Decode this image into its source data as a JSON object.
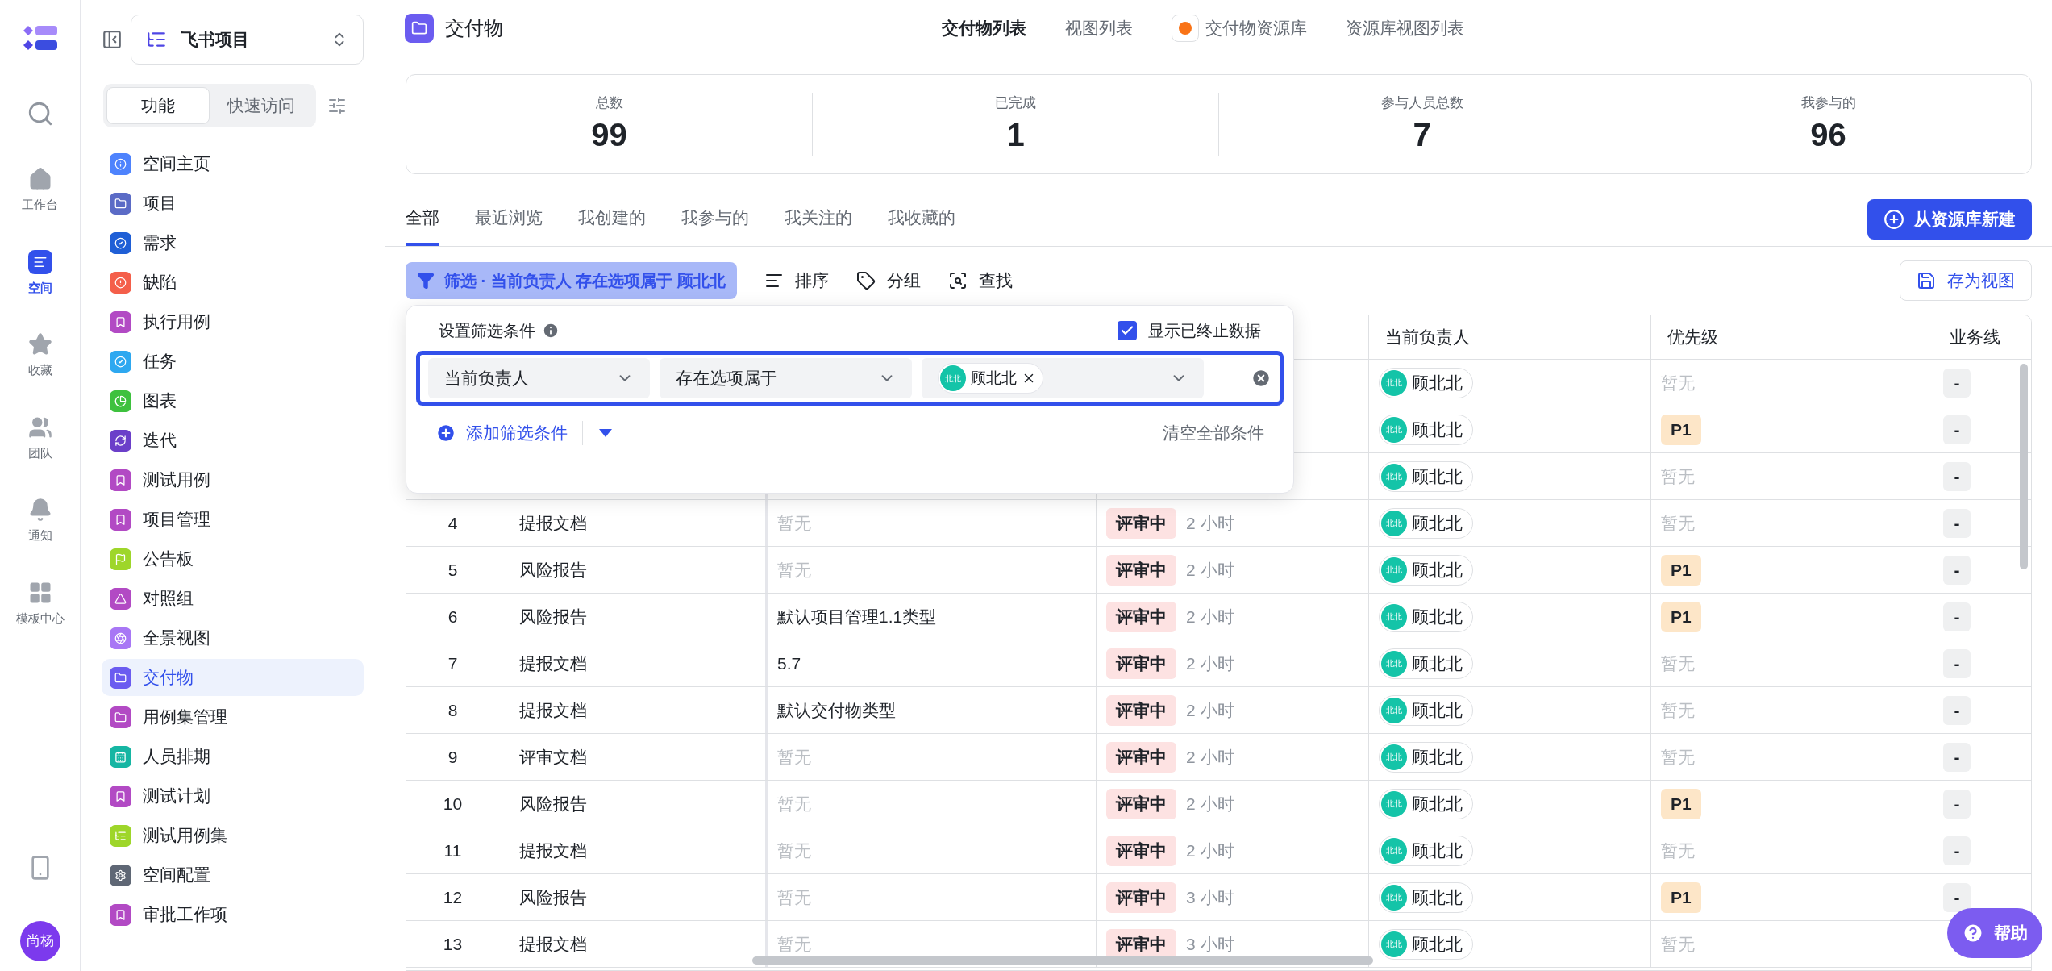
{
  "rail": {
    "items": [
      {
        "label": "工作台",
        "selected": false
      },
      {
        "label": "空间",
        "selected": true
      },
      {
        "label": "收藏",
        "selected": false
      },
      {
        "label": "团队",
        "selected": false
      },
      {
        "label": "通知",
        "selected": false
      },
      {
        "label": "模板中心",
        "selected": false
      }
    ],
    "avatar": "尚杨"
  },
  "sidebar": {
    "project": "飞书项目",
    "segments": [
      {
        "label": "功能",
        "selected": true
      },
      {
        "label": "快速访问",
        "selected": false
      }
    ],
    "items": [
      {
        "label": "空间主页",
        "color": "#4e83fd",
        "selected": false
      },
      {
        "label": "项目",
        "color": "#5b6bc6",
        "selected": false
      },
      {
        "label": "需求",
        "color": "#1f5fd6",
        "selected": false
      },
      {
        "label": "缺陷",
        "color": "#f45f4a",
        "selected": false
      },
      {
        "label": "执行用例",
        "color": "#b24ac4",
        "selected": false
      },
      {
        "label": "任务",
        "color": "#2ea8f0",
        "selected": false
      },
      {
        "label": "图表",
        "color": "#3ec13e",
        "selected": false
      },
      {
        "label": "迭代",
        "color": "#6b3fc9",
        "selected": false
      },
      {
        "label": "测试用例",
        "color": "#b24ac4",
        "selected": false
      },
      {
        "label": "项目管理",
        "color": "#b24ac4",
        "selected": false
      },
      {
        "label": "公告板",
        "color": "#9ed62a",
        "selected": false
      },
      {
        "label": "对照组",
        "color": "#b24ac4",
        "selected": false
      },
      {
        "label": "全景视图",
        "color": "#a877f5",
        "selected": false
      },
      {
        "label": "交付物",
        "color": "#6b5cf0",
        "selected": true
      },
      {
        "label": "用例集管理",
        "color": "#b24ac4",
        "selected": false
      },
      {
        "label": "人员排期",
        "color": "#16b6a3",
        "selected": false
      },
      {
        "label": "测试计划",
        "color": "#b24ac4",
        "selected": false
      },
      {
        "label": "测试用例集",
        "color": "#9ed62a",
        "selected": false
      },
      {
        "label": "空间配置",
        "color": "#5f6775",
        "selected": false
      },
      {
        "label": "审批工作项",
        "color": "#b24ac4",
        "selected": false
      }
    ]
  },
  "header": {
    "title": "交付物",
    "tabs": [
      {
        "label": "交付物列表",
        "selected": true
      },
      {
        "label": "视图列表",
        "selected": false
      },
      {
        "label": "交付物资源库",
        "selected": false
      },
      {
        "label": "资源库视图列表",
        "selected": false
      }
    ]
  },
  "stats": [
    {
      "label": "总数",
      "value": "99"
    },
    {
      "label": "已完成",
      "value": "1"
    },
    {
      "label": "参与人员总数",
      "value": "7"
    },
    {
      "label": "我参与的",
      "value": "96"
    }
  ],
  "view_tabs": [
    {
      "label": "全部",
      "selected": true
    },
    {
      "label": "最近浏览",
      "selected": false
    },
    {
      "label": "我创建的",
      "selected": false
    },
    {
      "label": "我参与的",
      "selected": false
    },
    {
      "label": "我关注的",
      "selected": false
    },
    {
      "label": "我收藏的",
      "selected": false
    }
  ],
  "new_button": "从资源库新建",
  "toolbar": {
    "filter": "筛选 · 当前负责人 存在选项属于 顾北北",
    "actions": [
      "排序",
      "分组",
      "查找"
    ],
    "save": "存为视图"
  },
  "filter_popup": {
    "title": "设置筛选条件",
    "show_terminated": {
      "label": "显示已终止数据",
      "checked": true
    },
    "field": "当前负责人",
    "operator": "存在选项属于",
    "value": {
      "avatar": "北北",
      "name": "顾北北"
    },
    "add": "添加筛选条件",
    "clear": "清空全部条件"
  },
  "table": {
    "columns": [
      "当前负责人",
      "优先级",
      "业务线"
    ],
    "rows": [
      {
        "owner": {
          "avatar": "北北",
          "name": "顾北北"
        },
        "priority": {
          "kind": "empty",
          "text": "暂无"
        },
        "business": "-"
      },
      {
        "owner": {
          "avatar": "北北",
          "name": "顾北北"
        },
        "priority": {
          "kind": "tag",
          "text": "P1"
        },
        "business": "-"
      },
      {
        "owner": {
          "avatar": "北北",
          "name": "顾北北"
        },
        "priority": {
          "kind": "empty",
          "text": "暂无"
        },
        "business": "-"
      },
      {
        "number": "4",
        "type": "提报文档",
        "description": {
          "text": "暂无",
          "muted": true
        },
        "status": "评审中",
        "duration": "2 小时",
        "owner": {
          "avatar": "北北",
          "name": "顾北北"
        },
        "priority": {
          "kind": "empty",
          "text": "暂无"
        },
        "business": "-"
      },
      {
        "number": "5",
        "type": "风险报告",
        "description": {
          "text": "暂无",
          "muted": true
        },
        "status": "评审中",
        "duration": "2 小时",
        "owner": {
          "avatar": "北北",
          "name": "顾北北"
        },
        "priority": {
          "kind": "tag",
          "text": "P1"
        },
        "business": "-"
      },
      {
        "number": "6",
        "type": "风险报告",
        "description": {
          "text": "默认项目管理1.1类型",
          "muted": false
        },
        "status": "评审中",
        "duration": "2 小时",
        "owner": {
          "avatar": "北北",
          "name": "顾北北"
        },
        "priority": {
          "kind": "tag",
          "text": "P1"
        },
        "business": "-"
      },
      {
        "number": "7",
        "type": "提报文档",
        "description": {
          "text": "5.7",
          "muted": false
        },
        "status": "评审中",
        "duration": "2 小时",
        "owner": {
          "avatar": "北北",
          "name": "顾北北"
        },
        "priority": {
          "kind": "empty",
          "text": "暂无"
        },
        "business": "-"
      },
      {
        "number": "8",
        "type": "提报文档",
        "description": {
          "text": "默认交付物类型",
          "muted": false
        },
        "status": "评审中",
        "duration": "2 小时",
        "owner": {
          "avatar": "北北",
          "name": "顾北北"
        },
        "priority": {
          "kind": "empty",
          "text": "暂无"
        },
        "business": "-"
      },
      {
        "number": "9",
        "type": "评审文档",
        "description": {
          "text": "暂无",
          "muted": true
        },
        "status": "评审中",
        "duration": "2 小时",
        "owner": {
          "avatar": "北北",
          "name": "顾北北"
        },
        "priority": {
          "kind": "empty",
          "text": "暂无"
        },
        "business": "-"
      },
      {
        "number": "10",
        "type": "风险报告",
        "description": {
          "text": "暂无",
          "muted": true
        },
        "status": "评审中",
        "duration": "2 小时",
        "owner": {
          "avatar": "北北",
          "name": "顾北北"
        },
        "priority": {
          "kind": "tag",
          "text": "P1"
        },
        "business": "-"
      },
      {
        "number": "11",
        "type": "提报文档",
        "description": {
          "text": "暂无",
          "muted": true
        },
        "status": "评审中",
        "duration": "2 小时",
        "owner": {
          "avatar": "北北",
          "name": "顾北北"
        },
        "priority": {
          "kind": "empty",
          "text": "暂无"
        },
        "business": "-"
      },
      {
        "number": "12",
        "type": "风险报告",
        "description": {
          "text": "暂无",
          "muted": true
        },
        "status": "评审中",
        "duration": "3 小时",
        "owner": {
          "avatar": "北北",
          "name": "顾北北"
        },
        "priority": {
          "kind": "tag",
          "text": "P1"
        },
        "business": "-"
      },
      {
        "number": "13",
        "type": "提报文档",
        "description": {
          "text": "暂无",
          "muted": true
        },
        "status": "评审中",
        "duration": "3 小时",
        "owner": {
          "avatar": "北北",
          "name": "顾北北"
        },
        "priority": {
          "kind": "empty",
          "text": "暂无"
        }
      }
    ]
  },
  "help": "帮助"
}
